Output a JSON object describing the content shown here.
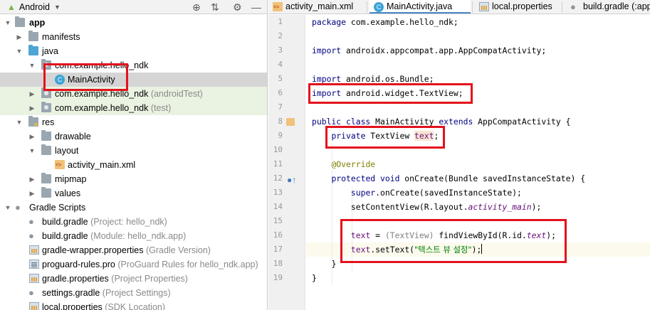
{
  "project_panel": {
    "view_label": "Android",
    "tree": [
      {
        "label": "app"
      },
      {
        "label": "manifests"
      },
      {
        "label": "java"
      },
      {
        "label": "com.example.hello_ndk"
      },
      {
        "label": "MainActivity"
      },
      {
        "label": "com.example.hello_ndk",
        "suffix": "(androidTest)"
      },
      {
        "label": "com.example.hello_ndk",
        "suffix": "(test)"
      },
      {
        "label": "res"
      },
      {
        "label": "drawable"
      },
      {
        "label": "layout"
      },
      {
        "label": "activity_main.xml"
      },
      {
        "label": "mipmap"
      },
      {
        "label": "values"
      },
      {
        "label": "Gradle Scripts"
      },
      {
        "label": "build.gradle",
        "suffix": "(Project: hello_ndk)"
      },
      {
        "label": "build.gradle",
        "suffix": "(Module: hello_ndk.app)"
      },
      {
        "label": "gradle-wrapper.properties",
        "suffix": "(Gradle Version)"
      },
      {
        "label": "proguard-rules.pro",
        "suffix": "(ProGuard Rules for hello_ndk.app)"
      },
      {
        "label": "gradle.properties",
        "suffix": "(Project Properties)"
      },
      {
        "label": "settings.gradle",
        "suffix": "(Project Settings)"
      },
      {
        "label": "local.properties",
        "suffix": "(SDK Location)"
      }
    ]
  },
  "tabs": [
    {
      "label": "activity_main.xml"
    },
    {
      "label": "MainActivity.java"
    },
    {
      "label": "local.properties"
    },
    {
      "label": "build.gradle (:app"
    }
  ],
  "editor": {
    "line_numbers": [
      "1",
      "2",
      "3",
      "4",
      "5",
      "6",
      "7",
      "8",
      "9",
      "10",
      "11",
      "12",
      "13",
      "14",
      "15",
      "16",
      "17",
      "18",
      "19"
    ],
    "code": {
      "l1_kw": "package",
      "l1_rest": " com.example.hello_ndk;",
      "l3_kw": "import",
      "l3_rest": " androidx.appcompat.app.AppCompatActivity;",
      "l5_kw": "import",
      "l5_rest": " android.os.Bundle;",
      "l6_kw": "import",
      "l6_rest": " android.widget.TextView;",
      "l8_kw": "public class",
      "l8_name": " MainActivity ",
      "l8_kw2": "extends",
      "l8_rest": " AppCompatActivity {",
      "l9_kw": "private",
      "l9_type": " TextView ",
      "l9_field": "text",
      "l9_end": ";",
      "l11_ann": "@Override",
      "l12_kw": "protected void",
      "l12_rest": " onCreate(Bundle savedInstanceState) {",
      "l13_kw": "super",
      "l13_rest": ".onCreate(savedInstanceState);",
      "l14_a": "setContentView(R.layout.",
      "l14_field": "activity_main",
      "l14_b": ");",
      "l16_field": "text",
      "l16_a": " = ",
      "l16_cast": "(TextView)",
      "l16_b": " findViewById(R.id.",
      "l16_field2": "text",
      "l16_c": ");",
      "l17_field": "text",
      "l17_a": ".setText(",
      "l17_str": "\"텍스트 뷰 설정\"",
      "l17_b": ");",
      "l18": "}",
      "l19": "}"
    }
  },
  "colors": {
    "keyword": "#000080",
    "field": "#660e7a",
    "annotation": "#808000",
    "string": "#008000",
    "annotation_box": "#e3121c",
    "tab_underline": "#4a88c7"
  },
  "icons": [
    "android-icon",
    "target-icon",
    "collapse-icon",
    "gear-icon",
    "minimize-icon",
    "folder-icon",
    "package-icon",
    "class-icon",
    "xml-file-icon",
    "gradle-icon",
    "properties-file-icon",
    "override-icon",
    "bookmark-icon"
  ]
}
